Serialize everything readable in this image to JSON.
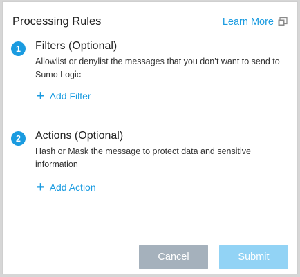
{
  "header": {
    "title": "Processing Rules",
    "learn_more": "Learn More",
    "learn_more_icon": "external-link-icon"
  },
  "steps": [
    {
      "number": "1",
      "title": "Filters (Optional)",
      "description": "Allowlist or denylist the messages that you don’t want to send to Sumo Logic",
      "action_label": "Add Filter"
    },
    {
      "number": "2",
      "title": "Actions (Optional)",
      "description": "Hash or Mask the message to protect data and sensitive information",
      "action_label": "Add Action"
    }
  ],
  "footer": {
    "cancel_label": "Cancel",
    "submit_label": "Submit"
  },
  "colors": {
    "accent": "#1a9be0",
    "cancel_bg": "#a5b1bc",
    "submit_bg_disabled": "#92d3f5"
  }
}
